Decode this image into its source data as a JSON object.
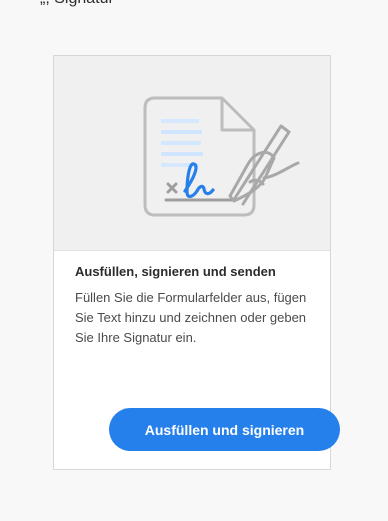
{
  "top_line": "„, Signatur",
  "card": {
    "illustration_icon": "document-signature-icon",
    "title": "Ausfüllen, signieren und senden",
    "description": "Füllen Sie die Formularfelder aus, fügen Sie Text hinzu und zeichnen oder geben Sie Ihre Signatur ein.",
    "button_label": "Ausfüllen und signieren"
  },
  "colors": {
    "background": "#f8f8f8",
    "card_background": "#ffffff",
    "illustration_background": "#f0f0f0",
    "button_blue": "#2680eb",
    "text_dark": "#2c2c2c",
    "text_secondary": "#4b4b4b"
  }
}
